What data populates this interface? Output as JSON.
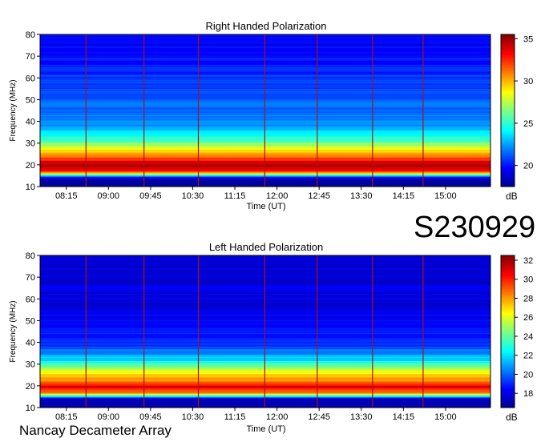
{
  "observation_label": "S230929",
  "instrument_label": "Nancay Decameter Array",
  "chart_data": [
    {
      "type": "heatmap",
      "title": "Right Handed Polarization",
      "xlabel": "Time (UT)",
      "ylabel": "Frequency (MHz)",
      "x_ticks": [
        "08:15",
        "09:00",
        "09:45",
        "10:30",
        "11:15",
        "12:00",
        "12:45",
        "13:30",
        "14:15",
        "15:00"
      ],
      "y_ticks": [
        10,
        20,
        30,
        40,
        50,
        60,
        70,
        80
      ],
      "ylim": [
        10,
        80
      ],
      "colorbar": {
        "min": 17.5,
        "max": 35.5,
        "ticks": [
          20,
          25,
          30,
          35
        ],
        "unit": "dB",
        "colormap": "jet"
      },
      "intensity_profile": [
        {
          "freq_MHz": 10,
          "level_dB": 18
        },
        {
          "freq_MHz": 14,
          "level_dB": 18.5
        },
        {
          "freq_MHz": 17,
          "level_dB": 33
        },
        {
          "freq_MHz": 20,
          "level_dB": 35
        },
        {
          "freq_MHz": 23,
          "level_dB": 32
        },
        {
          "freq_MHz": 27,
          "level_dB": 29
        },
        {
          "freq_MHz": 32,
          "level_dB": 25
        },
        {
          "freq_MHz": 40,
          "level_dB": 22
        },
        {
          "freq_MHz": 55,
          "level_dB": 21
        },
        {
          "freq_MHz": 70,
          "level_dB": 20
        },
        {
          "freq_MHz": 80,
          "level_dB": 20
        }
      ],
      "marker_times": [
        "08:36",
        "09:38",
        "10:36",
        "11:47",
        "12:43",
        "13:42",
        "14:36"
      ]
    },
    {
      "type": "heatmap",
      "title": "Left Handed Polarization",
      "xlabel": "Time (UT)",
      "ylabel": "Frequency (MHz)",
      "x_ticks": [
        "08:15",
        "09:00",
        "09:45",
        "10:30",
        "11:15",
        "12:00",
        "12:45",
        "13:30",
        "14:15",
        "15:00"
      ],
      "y_ticks": [
        10,
        20,
        30,
        40,
        50,
        60,
        70,
        80
      ],
      "ylim": [
        10,
        80
      ],
      "colorbar": {
        "min": 16.5,
        "max": 32.5,
        "ticks": [
          18,
          20,
          22,
          24,
          26,
          28,
          30,
          32
        ],
        "unit": "dB",
        "colormap": "jet"
      },
      "intensity_profile": [
        {
          "freq_MHz": 10,
          "level_dB": 17
        },
        {
          "freq_MHz": 14,
          "level_dB": 17.5
        },
        {
          "freq_MHz": 17,
          "level_dB": 29
        },
        {
          "freq_MHz": 20,
          "level_dB": 31
        },
        {
          "freq_MHz": 23,
          "level_dB": 28
        },
        {
          "freq_MHz": 27,
          "level_dB": 26
        },
        {
          "freq_MHz": 32,
          "level_dB": 22
        },
        {
          "freq_MHz": 40,
          "level_dB": 19
        },
        {
          "freq_MHz": 55,
          "level_dB": 18
        },
        {
          "freq_MHz": 70,
          "level_dB": 18
        },
        {
          "freq_MHz": 80,
          "level_dB": 18
        }
      ],
      "marker_times": [
        "08:36",
        "09:38",
        "10:36",
        "11:47",
        "12:43",
        "13:42",
        "14:36"
      ]
    }
  ]
}
